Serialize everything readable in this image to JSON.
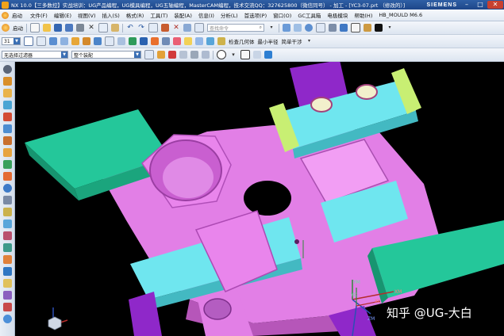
{
  "window": {
    "title": "NX 10.0【三多数控】实战培训：UG产品编程，UG模具编程，UG五轴编程，MasterCAM编程，技术交流QQ：327625800（微信同号） - 加工 - [YC3-07.prt （修改的）]",
    "brand": "SIEMENS",
    "minimize": "–",
    "maximize": "□",
    "close": "✕"
  },
  "menubar": {
    "start_label": "启动",
    "items": [
      "文件(F)",
      "编辑(E)",
      "视图(V)",
      "插入(S)",
      "格式(R)",
      "工具(T)",
      "装配(A)",
      "信息(I)",
      "分析(L)",
      "首选项(P)",
      "窗口(O)",
      "GC工具箱",
      "电极模块",
      "帮助(H)",
      "HB_MOULD M6.6"
    ]
  },
  "toolbar1": {
    "search_placeholder": "查找命令"
  },
  "toolbar2": {
    "number_value": "31",
    "check_geometry": "检查几何体",
    "min_radius": "最小半径",
    "simple_interference": "简单干涉"
  },
  "toolbar3": {
    "filter_value": "无选择过滤器",
    "scope_value": "整个装配"
  },
  "viewport": {
    "axis_ym": "YM",
    "axis_xm": "XM",
    "axis_yc": "YC",
    "axis_xc": "XC",
    "axis_zm": "ZM"
  },
  "watermark": "知乎 @UG-大白",
  "colors": {
    "part_body": "#e27fe6",
    "green_block": "#24c79a",
    "cyan_block": "#6fe6ef",
    "lime_block": "#c8ef73",
    "purple_block": "#8f28c9"
  }
}
